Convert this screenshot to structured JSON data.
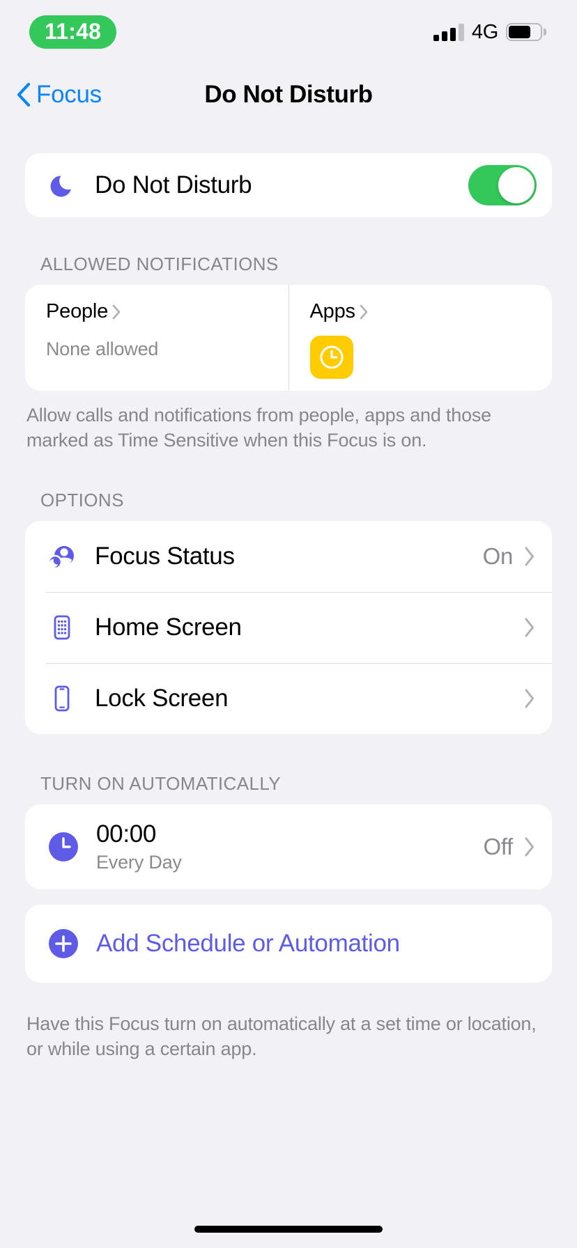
{
  "status_bar": {
    "time": "11:48",
    "time_pill_color": "#34C759",
    "network": "4G",
    "signal_icon": "signal-bars-icon",
    "battery_icon": "battery-icon",
    "signal_bars_filled": 3,
    "signal_bars_total": 4,
    "battery_level_percent": 70
  },
  "nav": {
    "back_label": "Focus",
    "back_icon": "chevron-left-icon",
    "title": "Do Not Disturb",
    "accent_color": "#0A84FF"
  },
  "dnd": {
    "icon": "moon-icon",
    "label": "Do Not Disturb",
    "toggle_state": "on",
    "toggle_on_color": "#34C759"
  },
  "allowed_notifications": {
    "header": "Allowed Notifications",
    "people": {
      "title": "People",
      "chevron_icon": "chevron-right-icon",
      "subtitle": "None allowed"
    },
    "apps": {
      "title": "Apps",
      "chevron_icon": "chevron-right-icon",
      "items": [
        {
          "name": "Clock",
          "icon": "clock-app-icon",
          "color": "#FFCC00"
        }
      ]
    },
    "footer": "Allow calls and notifications from people, apps and those marked as Time Sensitive when this Focus is on."
  },
  "options": {
    "header": "Options",
    "rows": [
      {
        "label": "Focus Status",
        "value": "On",
        "icon": "focus-status-icon",
        "chevron_icon": "chevron-right-icon"
      },
      {
        "label": "Home Screen",
        "value": "",
        "icon": "home-screen-icon",
        "chevron_icon": "chevron-right-icon"
      },
      {
        "label": "Lock Screen",
        "value": "",
        "icon": "lock-screen-icon",
        "chevron_icon": "chevron-right-icon"
      }
    ]
  },
  "turn_on_automatically": {
    "header": "Turn On Automatically",
    "schedule": {
      "icon": "clock-circle-icon",
      "time": "00:00",
      "repeat": "Every Day",
      "value": "Off",
      "chevron_icon": "chevron-right-icon"
    },
    "add": {
      "icon": "plus-circle-icon",
      "label": "Add Schedule or Automation",
      "color": "#5E5CE6"
    },
    "footer": "Have this Focus turn on automatically at a set time or location, or while using a certain app."
  },
  "home_indicator": "home-indicator"
}
